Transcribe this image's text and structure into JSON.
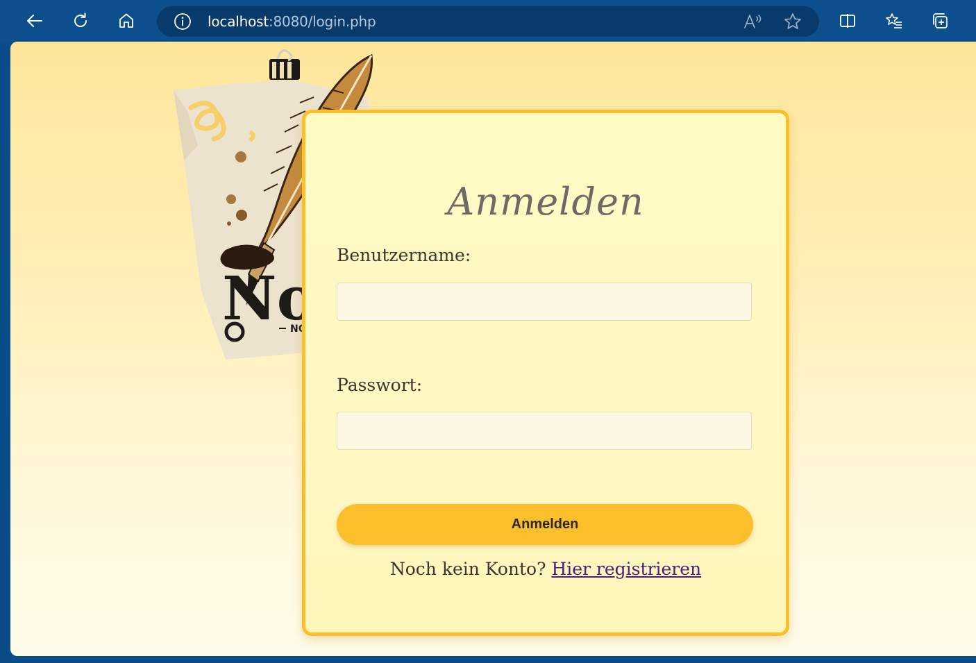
{
  "browser": {
    "url_host": "localhost",
    "url_rest": ":8080/login.php"
  },
  "logo": {
    "brand_text": "No",
    "brand_sub": "NO"
  },
  "login": {
    "title": "Anmelden",
    "username_label": "Benutzername:",
    "username_value": "",
    "password_label": "Passwort:",
    "password_value": "",
    "submit_label": "Anmelden",
    "register_prompt": "Noch kein Konto? ",
    "register_link": "Hier registrieren"
  },
  "colors": {
    "accent": "#fbbf2b",
    "link": "#4a1c80",
    "browser_frame": "#0d4f8d"
  }
}
